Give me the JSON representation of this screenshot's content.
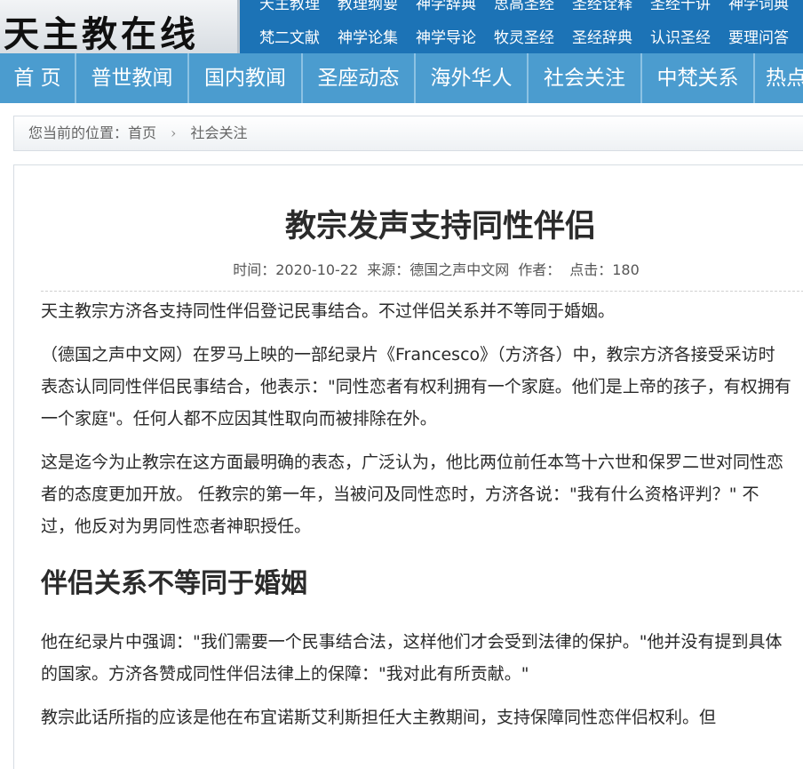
{
  "site": {
    "logo_text": "天主教在线"
  },
  "toplinks": {
    "row1": [
      "天主教理",
      "教理纲要",
      "神学辞典",
      "思高圣经",
      "圣经诠释",
      "圣经十讲",
      "神学词典"
    ],
    "row2": [
      "梵二文献",
      "神学论集",
      "神学导论",
      "牧灵圣经",
      "圣经辞典",
      "认识圣经",
      "要理问答"
    ]
  },
  "nav": [
    "首 页",
    "普世教闻",
    "国内教闻",
    "圣座动态",
    "海外华人",
    "社会关注",
    "中梵关系",
    "热点"
  ],
  "breadcrumb": {
    "prefix": "您当前的位置：",
    "home": "首页",
    "separator": "›",
    "current": "社会关注"
  },
  "article": {
    "title": "教宗发声支持同性伴侣",
    "meta": {
      "time": "时间：2020-10-22",
      "source": "来源：德国之声中文网",
      "author": "作者：",
      "clicks": "点击：180"
    },
    "paragraphs": [
      "天主教宗方济各支持同性伴侣登记民事结合。不过伴侣关系并不等同于婚姻。",
      "（德国之声中文网）在罗马上映的一部纪录片《Francesco》（方济各）中，教宗方济各接受采访时表态认同同性伴侣民事结合，他表示：\"同性恋者有权利拥有一个家庭。他们是上帝的孩子，有权拥有一个家庭\"。任何人都不应因其性取向而被排除在外。",
      "这是迄今为止教宗在这方面最明确的表态，广泛认为，他比两位前任本笃十六世和保罗二世对同性恋者的态度更加开放。 任教宗的第一年，当被问及同性恋时，方济各说：\"我有什么资格评判？\" 不过，他反对为男同性恋者神职授任。"
    ],
    "subheading": "伴侣关系不等同于婚姻",
    "paragraphs2": [
      "他在纪录片中强调：\"我们需要一个民事结合法，这样他们才会受到法律的保护。\"他并没有提到具体的国家。方济各赞成同性伴侣法律上的保障：\"我对此有所贡献。\"",
      "教宗此话所指的应该是他在布宜诺斯艾利斯担任大主教期间，支持保障同性恋伴侣权利。但"
    ]
  }
}
